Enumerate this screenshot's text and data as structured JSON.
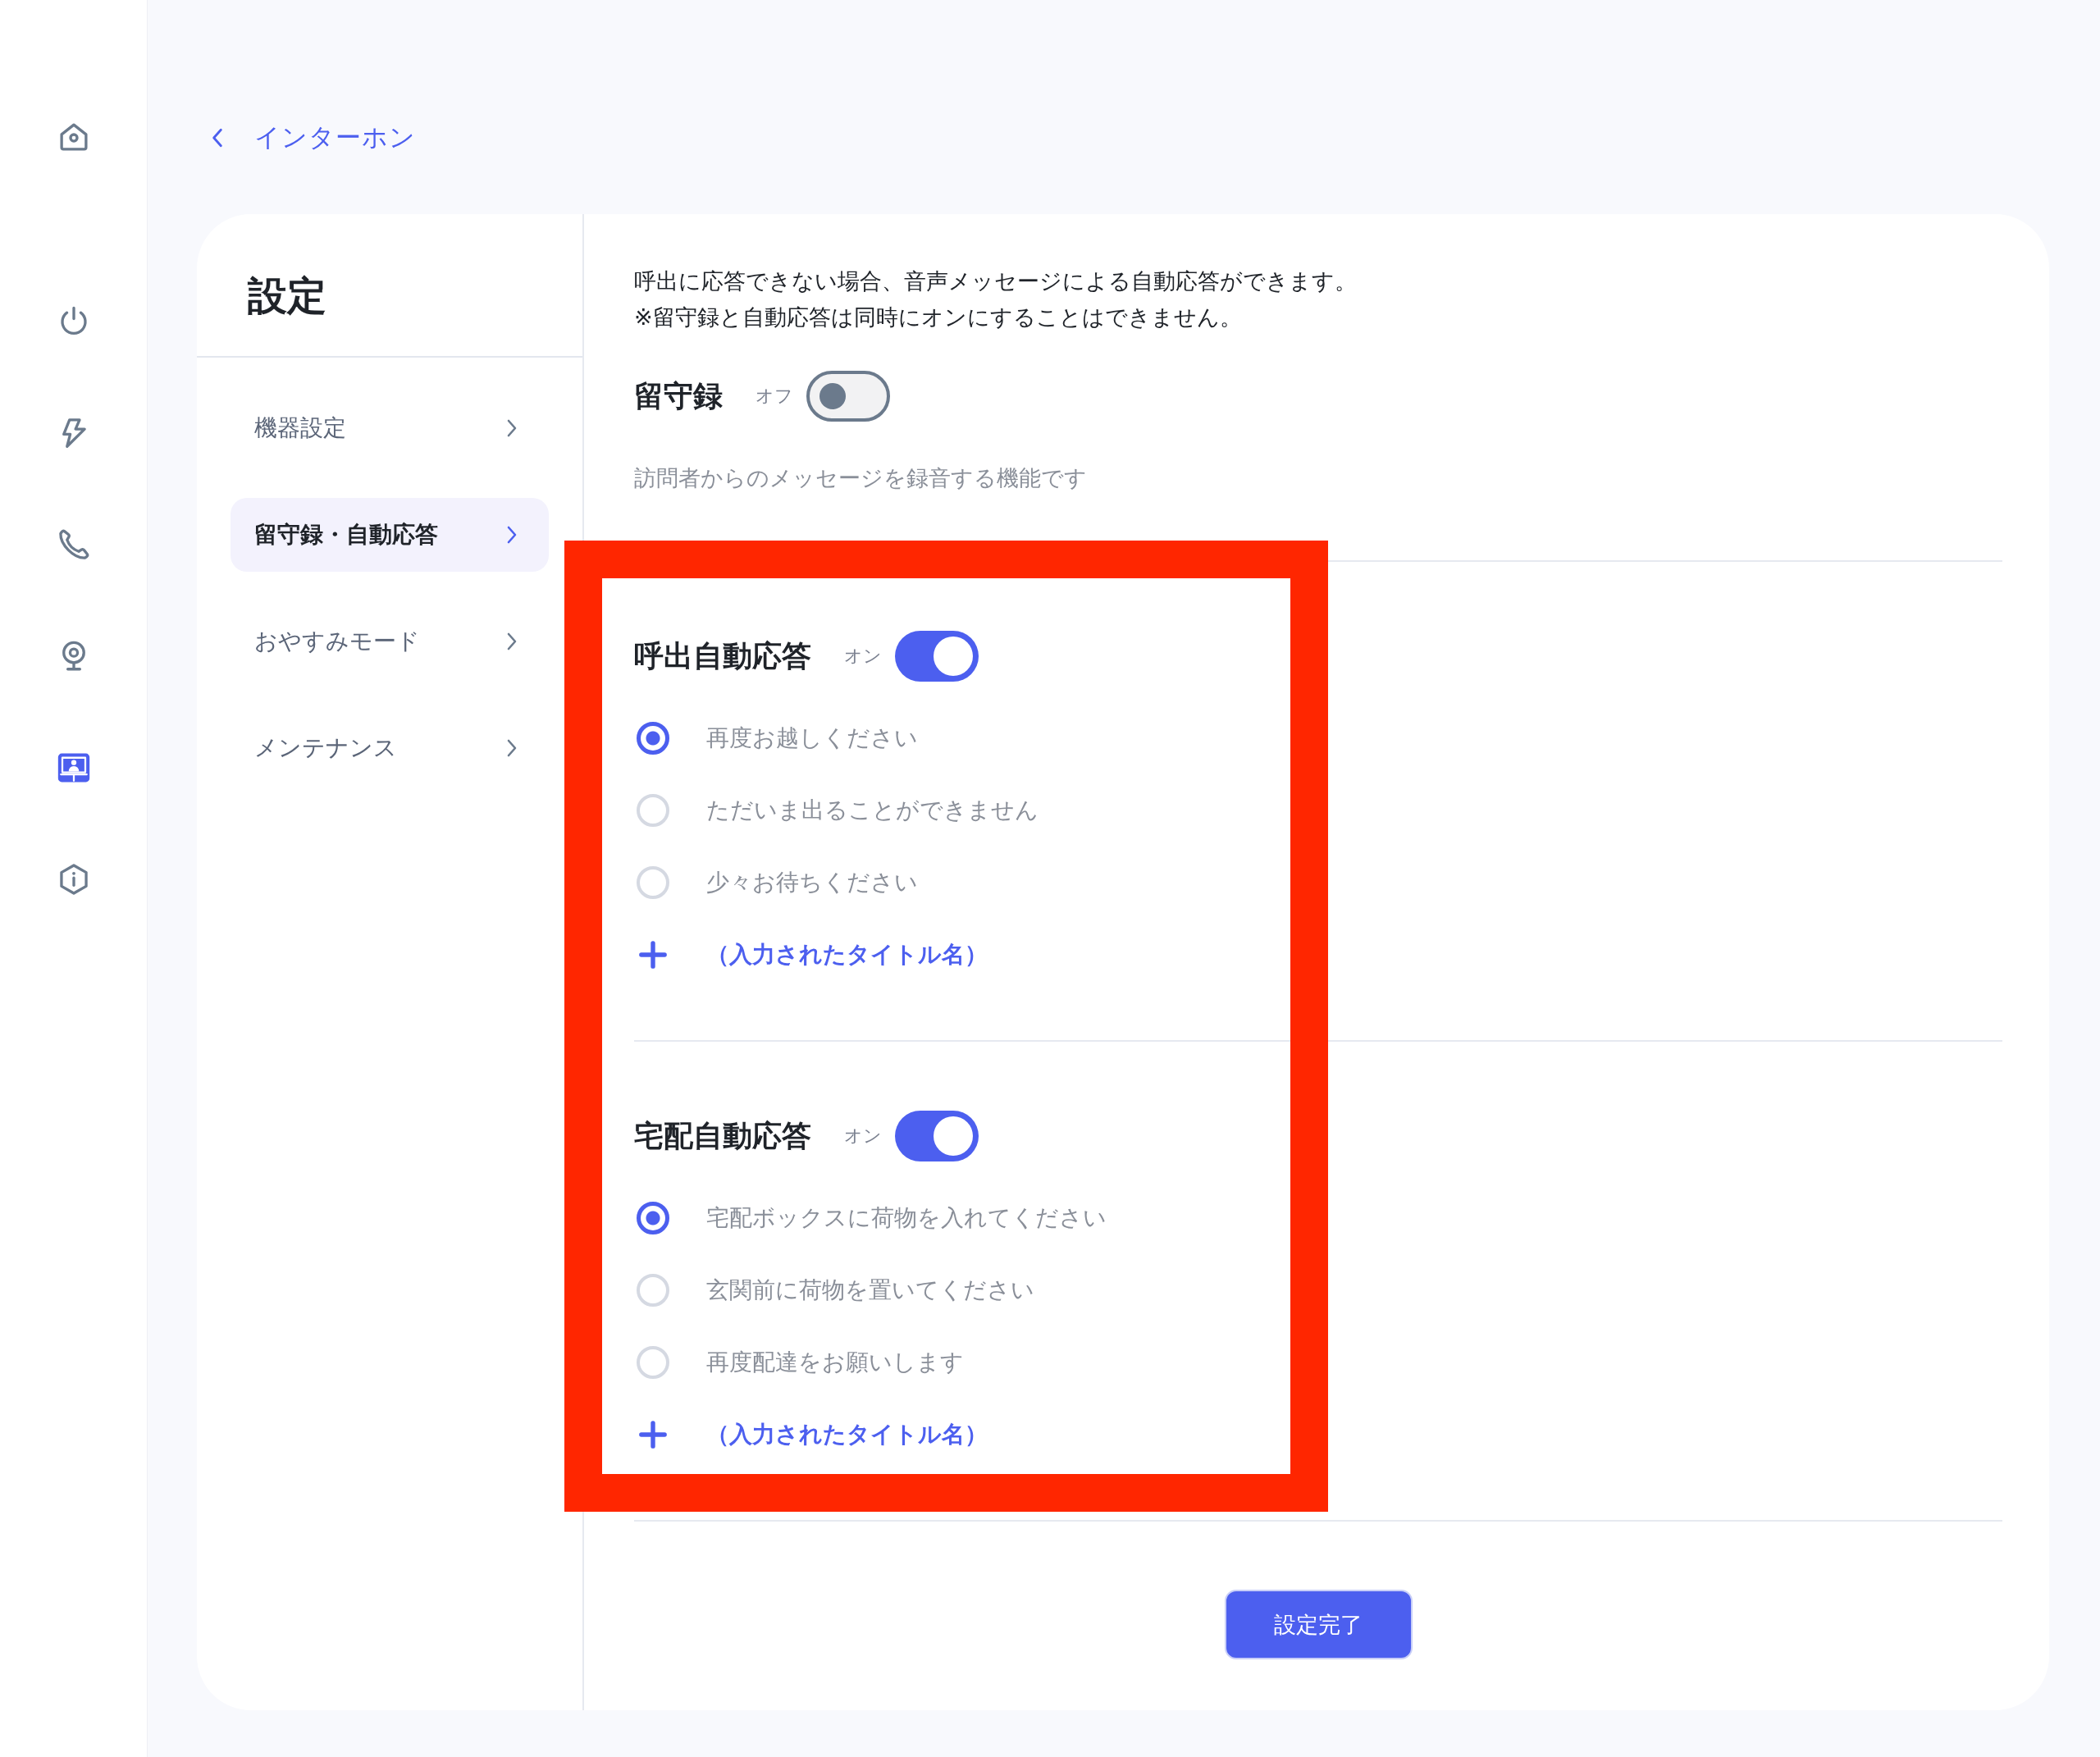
{
  "sidebar": {
    "items": [
      {
        "selected": false
      },
      {
        "selected": false
      },
      {
        "selected": false
      },
      {
        "selected": false
      },
      {
        "selected": false
      },
      {
        "selected": true
      },
      {
        "selected": false
      }
    ]
  },
  "back_link": {
    "label": "インターホン"
  },
  "settings_nav": {
    "title": "設定",
    "items": [
      {
        "label": "機器設定",
        "selected": false
      },
      {
        "label": "留守録・自動応答",
        "selected": true
      },
      {
        "label": "おやすみモード",
        "selected": false
      },
      {
        "label": "メンテナンス",
        "selected": false
      }
    ]
  },
  "description": [
    "呼出に応答できない場合、音声メッセージによる自動応答ができます。",
    "※留守録と自動応答は同時にオンにすることはできません。"
  ],
  "answering_machine": {
    "title": "留守録",
    "state_label": "オフ",
    "on": false,
    "note": "訪問者からのメッセージを録音する機能です"
  },
  "auto_responses": {
    "highlighted": true,
    "sections": [
      {
        "title": "呼出自動応答",
        "state_label": "オン",
        "on": true,
        "options": [
          {
            "label": "再度お越しください",
            "selected": true
          },
          {
            "label": "ただいま出ることができません",
            "selected": false
          },
          {
            "label": "少々お待ちください",
            "selected": false
          }
        ],
        "add_label": "（入力されたタイトル名）"
      },
      {
        "title": "宅配自動応答",
        "state_label": "オン",
        "on": true,
        "options": [
          {
            "label": "宅配ボックスに荷物を入れてください",
            "selected": true
          },
          {
            "label": "玄関前に荷物を置いてください",
            "selected": false
          },
          {
            "label": "再度配達をお願いします",
            "selected": false
          }
        ],
        "add_label": "（入力されたタイトル名）"
      }
    ]
  },
  "submit_button": {
    "label": "設定完了"
  }
}
